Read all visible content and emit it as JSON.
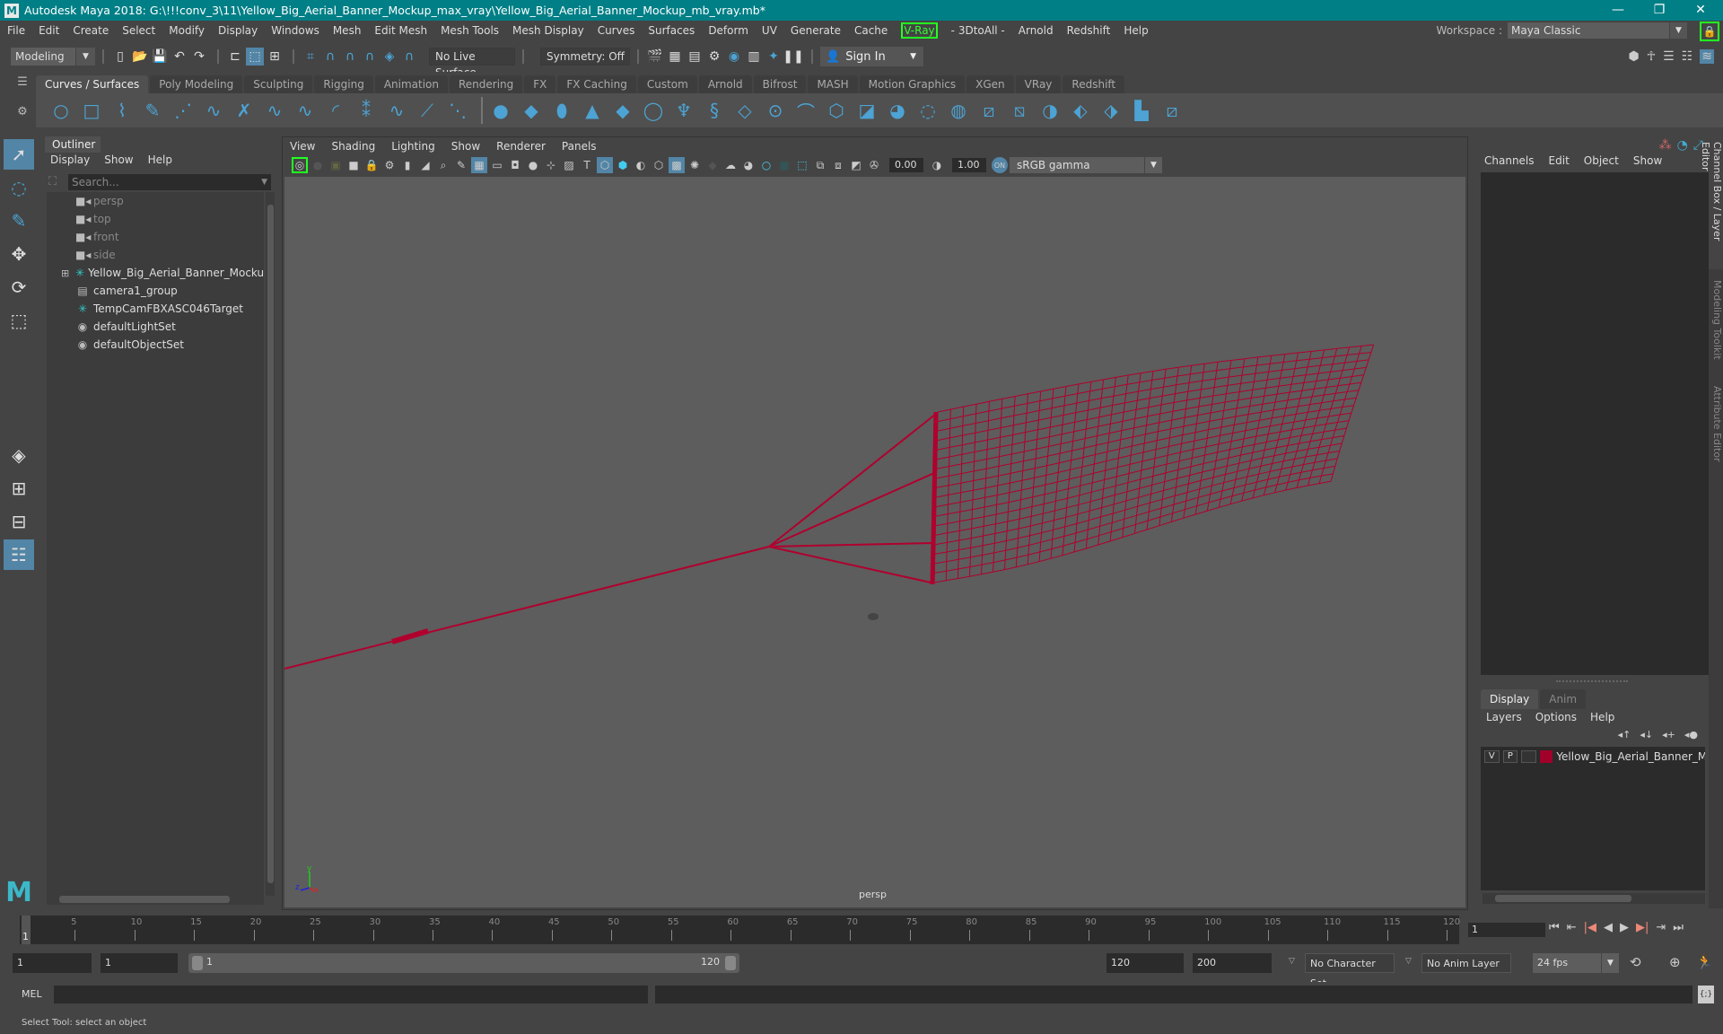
{
  "window": {
    "title": "Autodesk Maya 2018: G:\\!!!conv_3\\11\\Yellow_Big_Aerial_Banner_Mockup_max_vray\\Yellow_Big_Aerial_Banner_Mockup_mb_vray.mb*",
    "minimize": "—",
    "restore": "❐",
    "close": "✕"
  },
  "menubar": [
    "File",
    "Edit",
    "Create",
    "Select",
    "Modify",
    "Display",
    "Windows",
    "Mesh",
    "Edit Mesh",
    "Mesh Tools",
    "Mesh Display",
    "Curves",
    "Surfaces",
    "Deform",
    "UV",
    "Generate",
    "Cache",
    "V-Ray",
    "- 3DtoAll -",
    "Arnold",
    "Redshift",
    "Help"
  ],
  "workspace": {
    "label": "Workspace :",
    "value": "Maya Classic"
  },
  "statusline": {
    "mode": "Modeling",
    "live_surface": "No Live Surface",
    "symmetry": "Symmetry: Off",
    "sign_in": "Sign In"
  },
  "shelf": {
    "tabs": [
      "Curves / Surfaces",
      "Poly Modeling",
      "Sculpting",
      "Rigging",
      "Animation",
      "Rendering",
      "FX",
      "FX Caching",
      "Custom",
      "Arnold",
      "Bifrost",
      "MASH",
      "Motion Graphics",
      "XGen",
      "VRay",
      "Redshift"
    ],
    "active_tab": 0,
    "icons": [
      "nurbs-circle",
      "nurbs-square",
      "cv-curve",
      "pencil-curve",
      "ep-curve",
      "bezier-curve",
      "curve-tool",
      "attach-curve",
      "detach-curve",
      "arc-tool",
      "rebuild-curve",
      "offset-curve",
      "extend-curve",
      "insert-knot",
      "nurbs-sphere",
      "nurbs-cube",
      "nurbs-cylinder",
      "nurbs-cone",
      "nurbs-plane",
      "nurbs-torus",
      "revolve",
      "loft",
      "planar",
      "extrude",
      "birail",
      "bevel",
      "boundary",
      "square-surface",
      "trim",
      "untrim",
      "round",
      "project-curve",
      "intersect",
      "fillet",
      "stitch",
      "sculpt-surface",
      "rebuild-surface"
    ]
  },
  "outliner": {
    "title": "Outliner",
    "menu": [
      "Display",
      "Show",
      "Help"
    ],
    "search_placeholder": "Search...",
    "items": [
      {
        "label": "persp",
        "icon": "camera",
        "dim": true
      },
      {
        "label": "top",
        "icon": "camera",
        "dim": true
      },
      {
        "label": "front",
        "icon": "camera",
        "dim": true
      },
      {
        "label": "side",
        "icon": "camera",
        "dim": true
      },
      {
        "label": "Yellow_Big_Aerial_Banner_Mockup_n",
        "icon": "locator",
        "expandable": true
      },
      {
        "label": "camera1_group",
        "icon": "group"
      },
      {
        "label": "TempCamFBXASC046Target",
        "icon": "locator"
      },
      {
        "label": "defaultLightSet",
        "icon": "set"
      },
      {
        "label": "defaultObjectSet",
        "icon": "set"
      }
    ]
  },
  "viewport": {
    "menu": [
      "View",
      "Shading",
      "Lighting",
      "Show",
      "Renderer",
      "Panels"
    ],
    "exposure": "0.00",
    "gamma": "1.00",
    "color_space": "sRGB gamma",
    "camera_label": "persp",
    "wire_color": "#b0002e"
  },
  "channelbox": {
    "menu": [
      "Channels",
      "Edit",
      "Object",
      "Show"
    ],
    "side_tabs": [
      "Channel Box / Layer Editor",
      "Modeling Toolkit",
      "Attribute Editor"
    ]
  },
  "layers": {
    "tabs": [
      "Display",
      "Anim"
    ],
    "active_tab": 0,
    "menu": [
      "Layers",
      "Options",
      "Help"
    ],
    "rows": [
      {
        "v": "V",
        "p": "P",
        "color": "#a0002a",
        "name": "Yellow_Big_Aerial_Banner_Moc"
      }
    ]
  },
  "timeline": {
    "ticks": [
      5,
      10,
      15,
      20,
      25,
      30,
      35,
      40,
      45,
      50,
      55,
      60,
      65,
      70,
      75,
      80,
      85,
      90,
      95,
      100,
      105,
      110,
      115,
      120
    ],
    "min": 1,
    "max": 120,
    "current_frame": "1",
    "current_frame_field": "1"
  },
  "range": {
    "start": "1",
    "playback_start": "1",
    "slider_start": "1",
    "slider_end": "120",
    "playback_end": "120",
    "end": "200",
    "character_set": "No Character Set",
    "anim_layer": "No Anim Layer",
    "fps": "24 fps"
  },
  "command": {
    "lang": "MEL"
  },
  "status": {
    "help_line": "Select Tool: select an object"
  }
}
